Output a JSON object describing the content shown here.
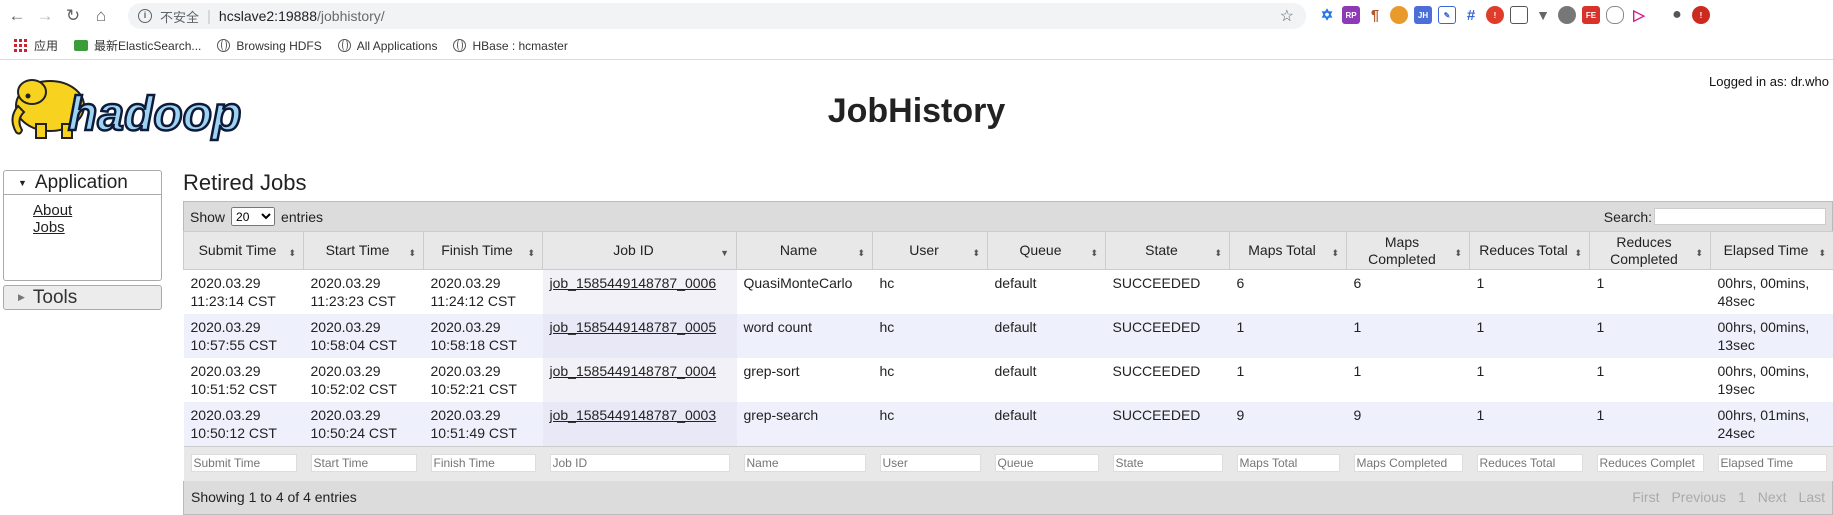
{
  "browser": {
    "security_label": "不安全",
    "url_host": "hcslave2:19888",
    "url_path": "/jobhistory/",
    "bookmarks": [
      {
        "label": "应用"
      },
      {
        "label": "最新ElasticSearch..."
      },
      {
        "label": "Browsing HDFS"
      },
      {
        "label": "All Applications"
      },
      {
        "label": "HBase : hcmaster"
      }
    ]
  },
  "header": {
    "title": "JobHistory",
    "logged_in": "Logged in as: dr.who",
    "logo_text": "hadoop"
  },
  "sidebar": {
    "application": "Application",
    "links": [
      "About",
      "Jobs"
    ],
    "tools": "Tools"
  },
  "main": {
    "heading": "Retired Jobs",
    "show_label": "Show",
    "entries_label": "entries",
    "page_size": "20",
    "search_label": "Search:",
    "columns": [
      "Submit Time",
      "Start Time",
      "Finish Time",
      "Job ID",
      "Name",
      "User",
      "Queue",
      "State",
      "Maps Total",
      "Maps Completed",
      "Reduces Total",
      "Reduces Completed",
      "Elapsed Time"
    ],
    "rows": [
      [
        "2020.03.29 11:23:14 CST",
        "2020.03.29 11:23:23 CST",
        "2020.03.29 11:24:12 CST",
        "job_1585449148787_0006",
        "QuasiMonteCarlo",
        "hc",
        "default",
        "SUCCEEDED",
        "6",
        "6",
        "1",
        "1",
        "00hrs, 00mins, 48sec"
      ],
      [
        "2020.03.29 10:57:55 CST",
        "2020.03.29 10:58:04 CST",
        "2020.03.29 10:58:18 CST",
        "job_1585449148787_0005",
        "word count",
        "hc",
        "default",
        "SUCCEEDED",
        "1",
        "1",
        "1",
        "1",
        "00hrs, 00mins, 13sec"
      ],
      [
        "2020.03.29 10:51:52 CST",
        "2020.03.29 10:52:02 CST",
        "2020.03.29 10:52:21 CST",
        "job_1585449148787_0004",
        "grep-sort",
        "hc",
        "default",
        "SUCCEEDED",
        "1",
        "1",
        "1",
        "1",
        "00hrs, 00mins, 19sec"
      ],
      [
        "2020.03.29 10:50:12 CST",
        "2020.03.29 10:50:24 CST",
        "2020.03.29 10:51:49 CST",
        "job_1585449148787_0003",
        "grep-search",
        "hc",
        "default",
        "SUCCEEDED",
        "9",
        "9",
        "1",
        "1",
        "00hrs, 01mins, 24sec"
      ]
    ],
    "filters": [
      "Submit Time",
      "Start Time",
      "Finish Time",
      "Job ID",
      "Name",
      "User",
      "Queue",
      "State",
      "Maps Total",
      "Maps Completed",
      "Reduces Total",
      "Reduces Complet",
      "Elapsed Time"
    ],
    "info": "Showing 1 to 4 of 4 entries",
    "paging": [
      "First",
      "Previous",
      "1",
      "Next",
      "Last"
    ]
  }
}
